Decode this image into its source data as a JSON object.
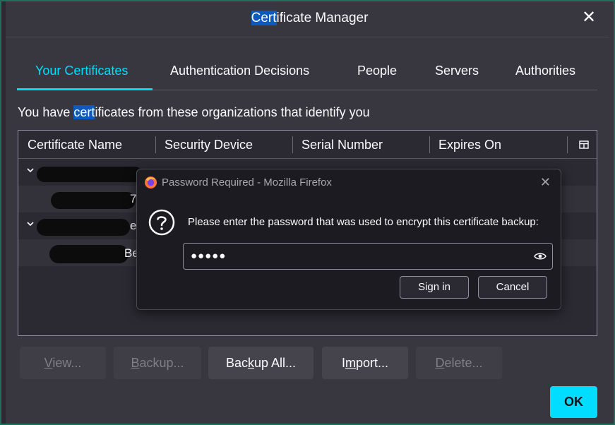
{
  "window": {
    "title_highlight": "Cert",
    "title_rest": "ificate Manager"
  },
  "tabs": [
    {
      "label": "Your Certificates"
    },
    {
      "label": "Authentication Decisions"
    },
    {
      "label": "People"
    },
    {
      "label": "Servers"
    },
    {
      "label": "Authorities"
    }
  ],
  "description": {
    "before": "You have ",
    "highlight": "cert",
    "after": "ificates from these organizations that identify you"
  },
  "table": {
    "columns": [
      "Certificate Name",
      "Security Device",
      "Serial Number",
      "Expires On"
    ],
    "visible_fragments": [
      "7",
      "e",
      "Be"
    ]
  },
  "buttons": {
    "view": {
      "pre": "",
      "u": "V",
      "post": "iew..."
    },
    "backup": {
      "pre": "",
      "u": "B",
      "post": "ackup..."
    },
    "backup_all": {
      "pre": "Bac",
      "u": "k",
      "post": "up All..."
    },
    "import": {
      "pre": "I",
      "u": "m",
      "post": "port..."
    },
    "delete": {
      "pre": "",
      "u": "D",
      "post": "elete..."
    },
    "ok": "OK"
  },
  "password_dialog": {
    "title": "Password Required - Mozilla Firefox",
    "message": "Please enter the password that was used to encrypt this certificate backup:",
    "masked_value": "●●●●●",
    "sign_in": "Sign in",
    "cancel": "Cancel"
  },
  "colors": {
    "accent": "#00ddff",
    "selection": "#0b5bbf",
    "dialog_bg": "#38363f"
  }
}
